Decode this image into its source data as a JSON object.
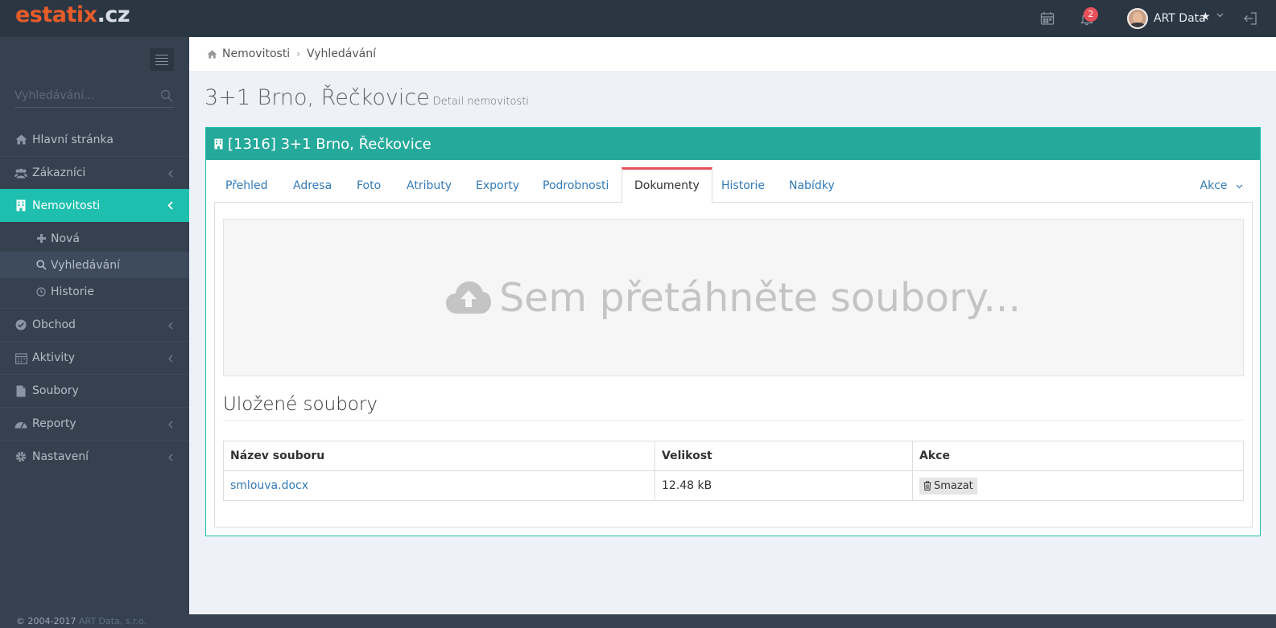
{
  "brand": {
    "part1": "estatix",
    "part2": ".cz"
  },
  "topbar": {
    "notifications_count": "2",
    "user_name": "ART Data"
  },
  "sidebar": {
    "search_placeholder": "Vyhledávání...",
    "items": [
      {
        "label": "Hlavní stránka"
      },
      {
        "label": "Zákazníci"
      },
      {
        "label": "Nemovitosti"
      },
      {
        "label": "Obchod"
      },
      {
        "label": "Aktivity"
      },
      {
        "label": "Soubory"
      },
      {
        "label": "Reporty"
      },
      {
        "label": "Nastavení"
      }
    ],
    "subitems": [
      {
        "label": "Nová"
      },
      {
        "label": "Vyhledávání"
      },
      {
        "label": "Historie"
      }
    ]
  },
  "breadcrumb": {
    "home": "Nemovitosti",
    "current": "Vyhledávání"
  },
  "page": {
    "title": "3+1 Brno, Řečkovice",
    "subtitle": "Detail nemovitosti"
  },
  "portlet": {
    "title": "[1316] 3+1 Brno, Řečkovice"
  },
  "tabs": [
    {
      "label": "Přehled"
    },
    {
      "label": "Adresa"
    },
    {
      "label": "Foto"
    },
    {
      "label": "Atributy"
    },
    {
      "label": "Exporty"
    },
    {
      "label": "Podrobnosti"
    },
    {
      "label": "Dokumenty"
    },
    {
      "label": "Historie"
    },
    {
      "label": "Nabídky"
    }
  ],
  "tab_actions_label": "Akce",
  "dropzone": {
    "text": "Sem přetáhněte soubory..."
  },
  "files": {
    "heading": "Uložené soubory",
    "columns": [
      "Název souboru",
      "Velikost",
      "Akce"
    ],
    "rows": [
      {
        "name": "smlouva.docx",
        "size": "12.48 kB",
        "action": "Smazat"
      }
    ]
  },
  "footer": {
    "text": "© 2004-2017",
    "company": "ART Data, s.r.o."
  },
  "colors": {
    "accent": "#1ebfae",
    "header": "#2b3643",
    "sidebar": "#364150",
    "active_tab": "#e7505a"
  }
}
